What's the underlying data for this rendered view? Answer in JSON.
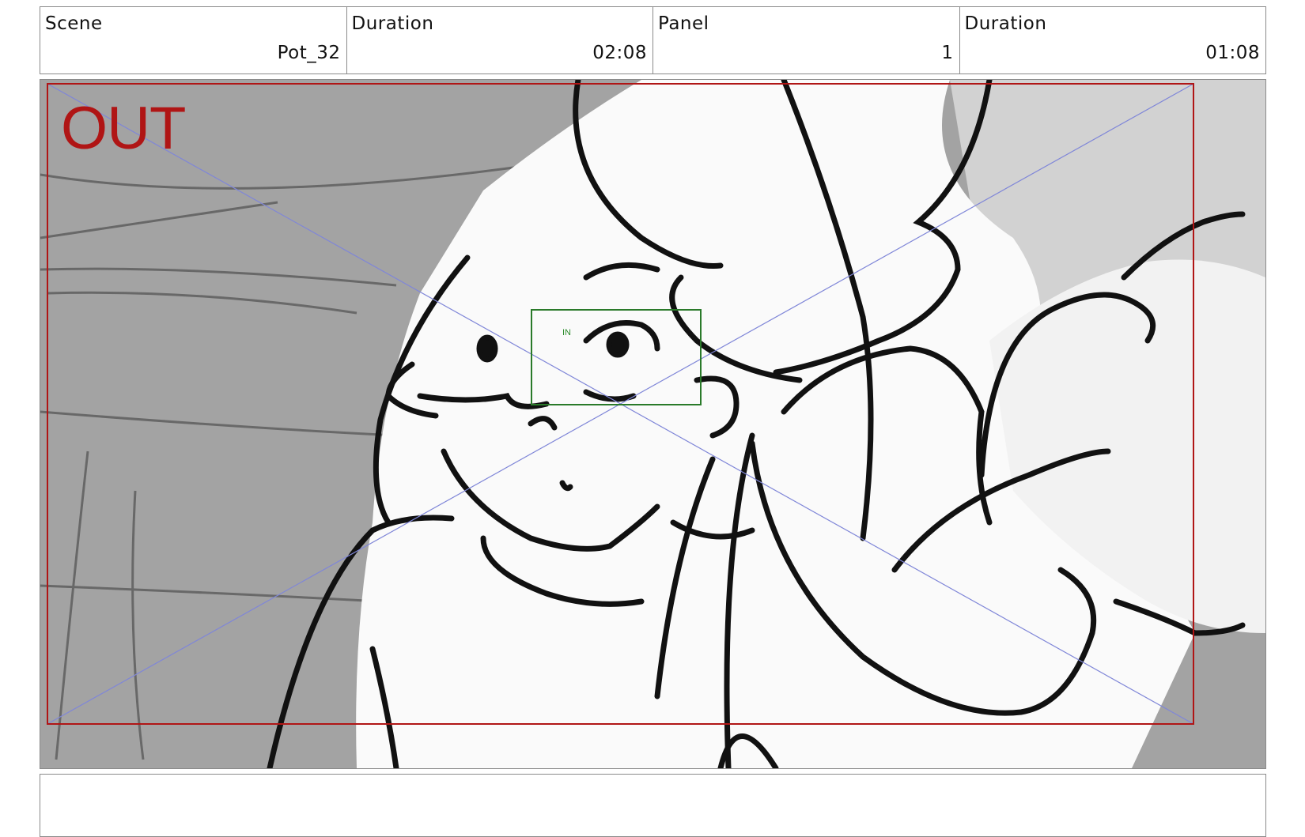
{
  "header": {
    "cells": [
      {
        "label": "Scene",
        "value": "Pot_32"
      },
      {
        "label": "Duration",
        "value": "02:08"
      },
      {
        "label": "Panel",
        "value": "1"
      },
      {
        "label": "Duration",
        "value": "01:08"
      }
    ]
  },
  "panel": {
    "out_label": "OUT",
    "in_label": "IN",
    "colors": {
      "out_frame": "#b01515",
      "in_frame": "#2a7a2a",
      "diagonals": "#7f86d8",
      "background_gray": "#9a9a9a"
    }
  },
  "notes": {
    "text": ""
  }
}
